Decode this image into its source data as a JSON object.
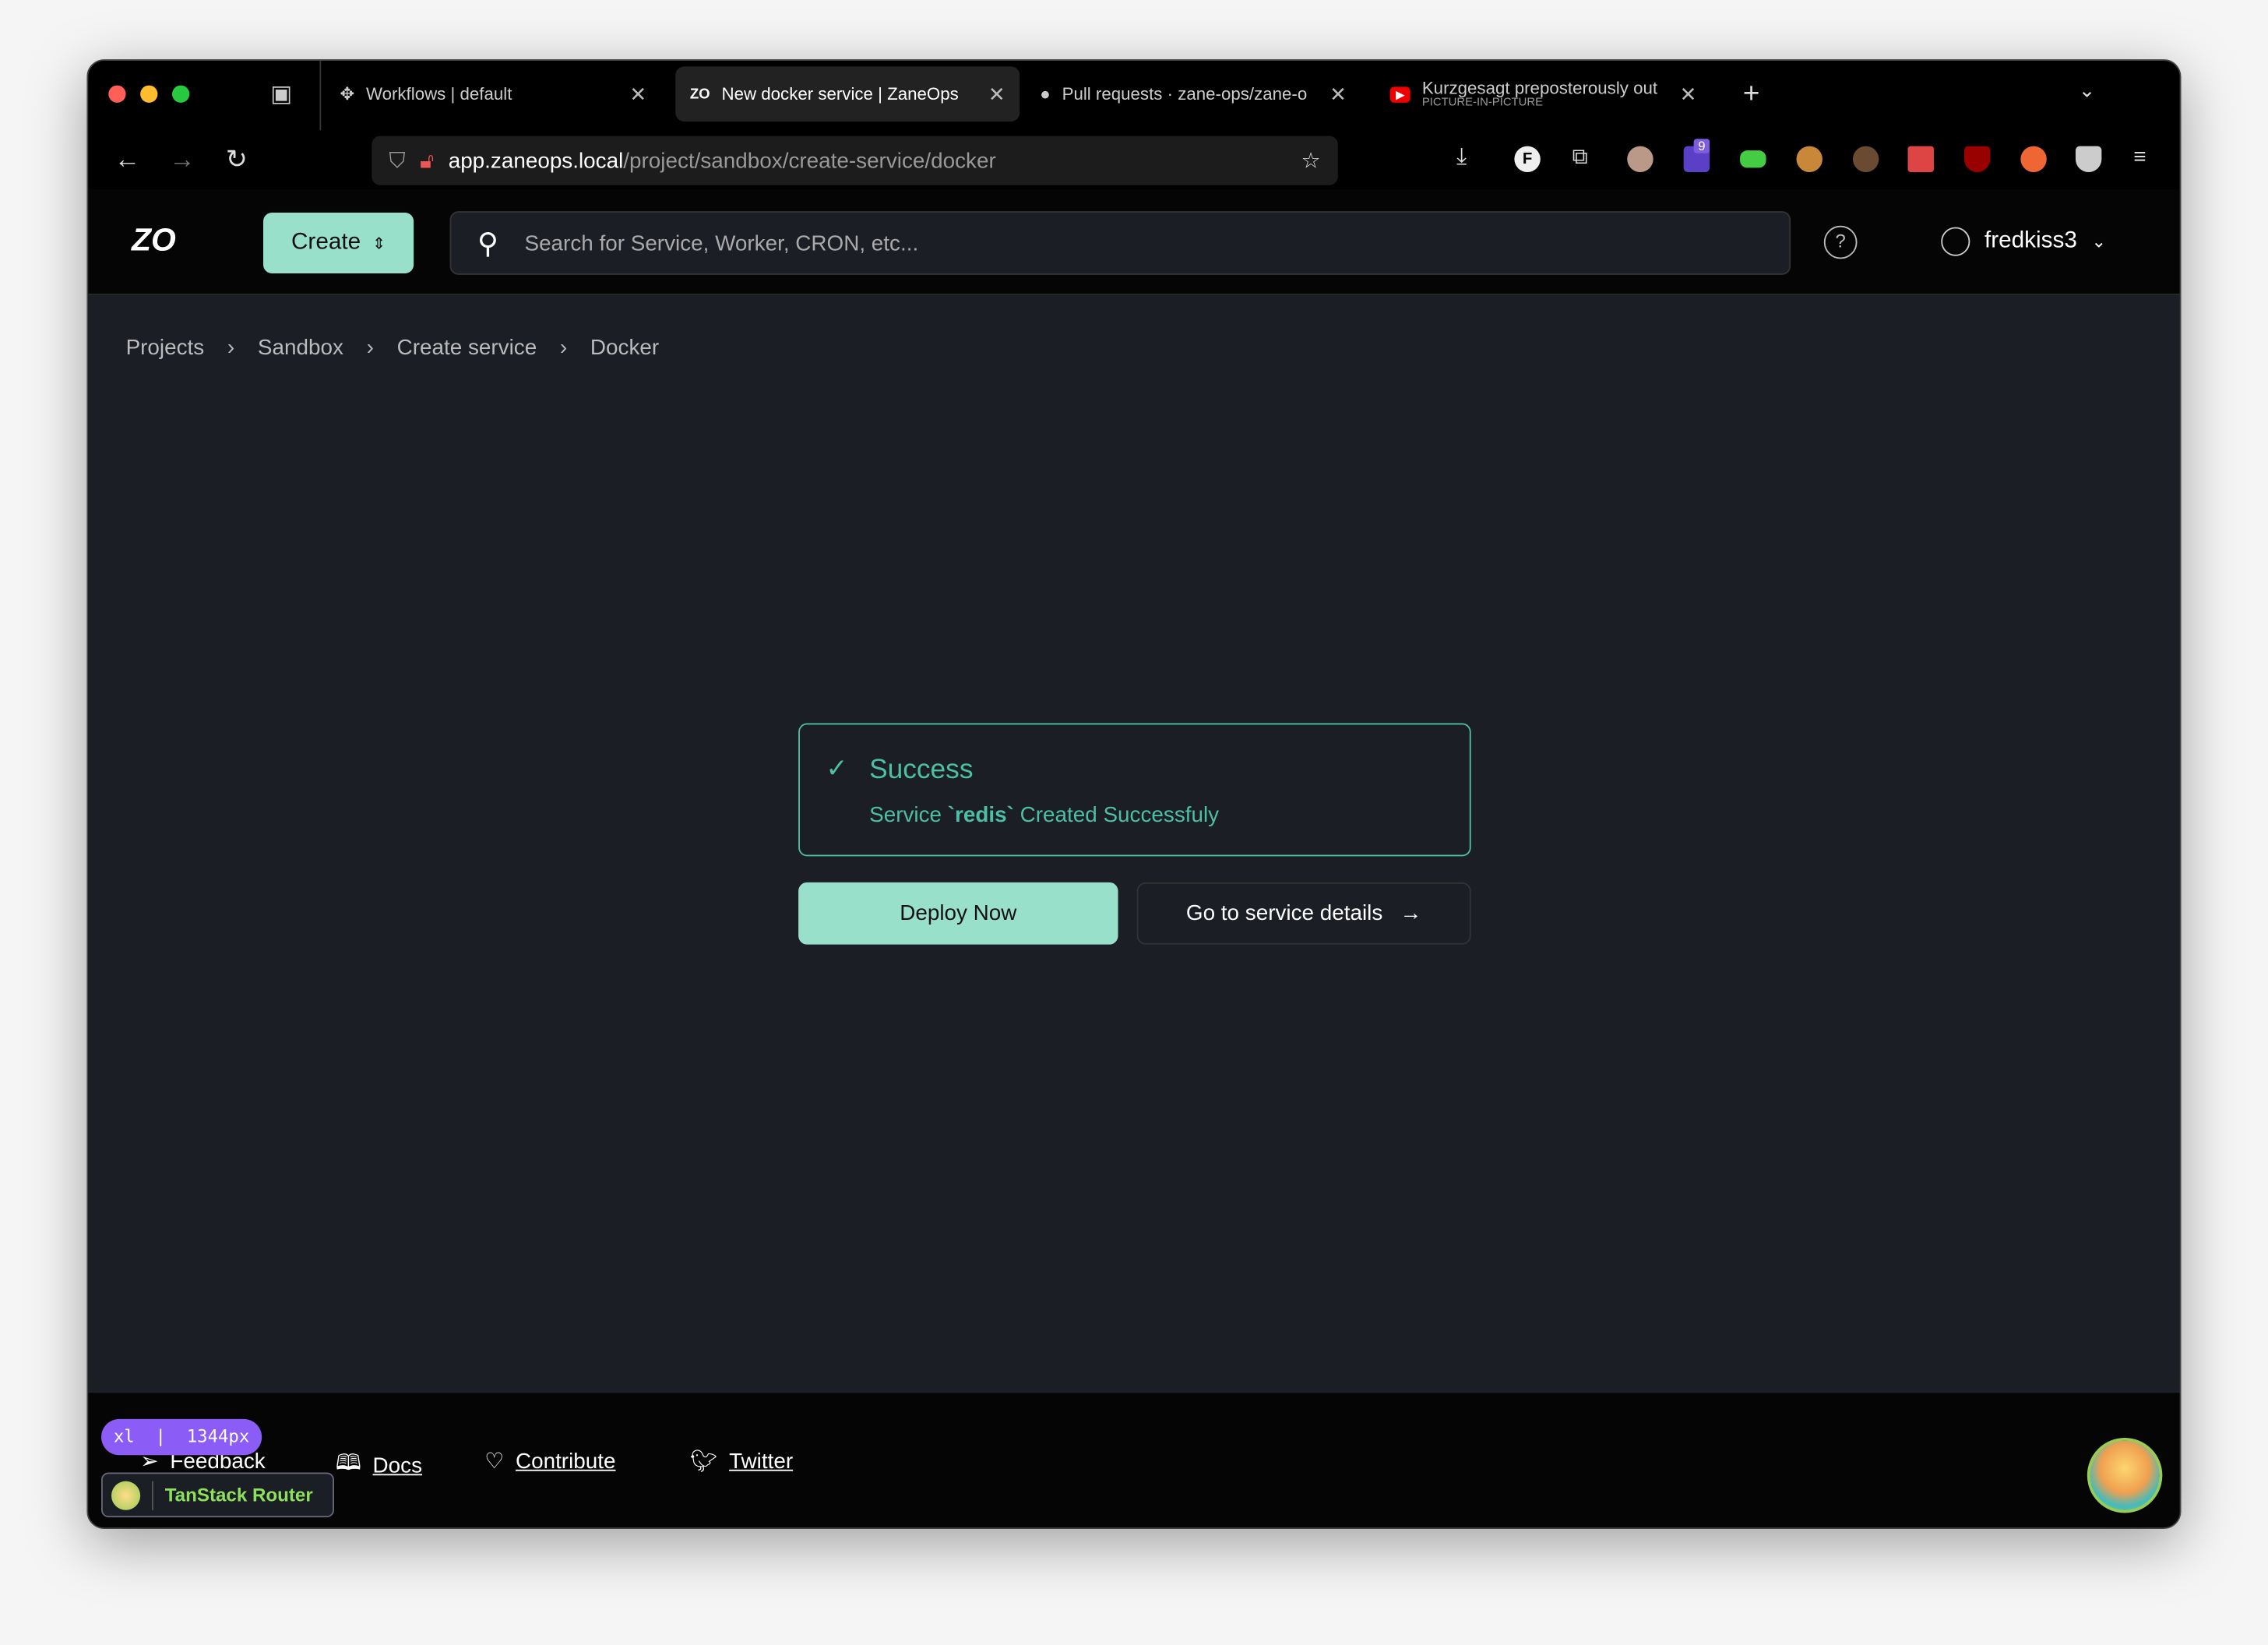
{
  "browser": {
    "tabs": [
      {
        "label": "Workflows | default",
        "active": false
      },
      {
        "label": "New docker service | ZaneOps",
        "active": true
      },
      {
        "label": "Pull requests · zane-ops/zane-o",
        "active": false
      },
      {
        "label": "Kurzgesagt preposterously out",
        "sublabel": "PICTURE-IN-PICTURE",
        "active": false
      }
    ],
    "url_domain": "app.zaneops.local",
    "url_path": "/project/sandbox/create-service/docker",
    "extension_badge": "9"
  },
  "header": {
    "logo": "ZO",
    "create_label": "Create",
    "search_placeholder": "Search for Service, Worker, CRON, etc...",
    "username": "fredkiss3"
  },
  "breadcrumb": [
    "Projects",
    "Sandbox",
    "Create service",
    "Docker"
  ],
  "alert": {
    "title": "Success",
    "message_prefix": "Service ",
    "service_name": "`redis`",
    "message_suffix": " Created Successfuly",
    "color": "#4dbfa5"
  },
  "actions": {
    "deploy_label": "Deploy Now",
    "details_label": "Go to service details"
  },
  "footer": {
    "links": [
      "Feedback",
      "Docs",
      "Contribute",
      "Twitter"
    ]
  },
  "devtools": {
    "breakpoint": "xl  |  1344px",
    "router_label": "TanStack Router"
  },
  "colors": {
    "accent": "#99e0cb",
    "background": "#1c1e26",
    "breakpoint_badge": "#8b5cf6"
  }
}
